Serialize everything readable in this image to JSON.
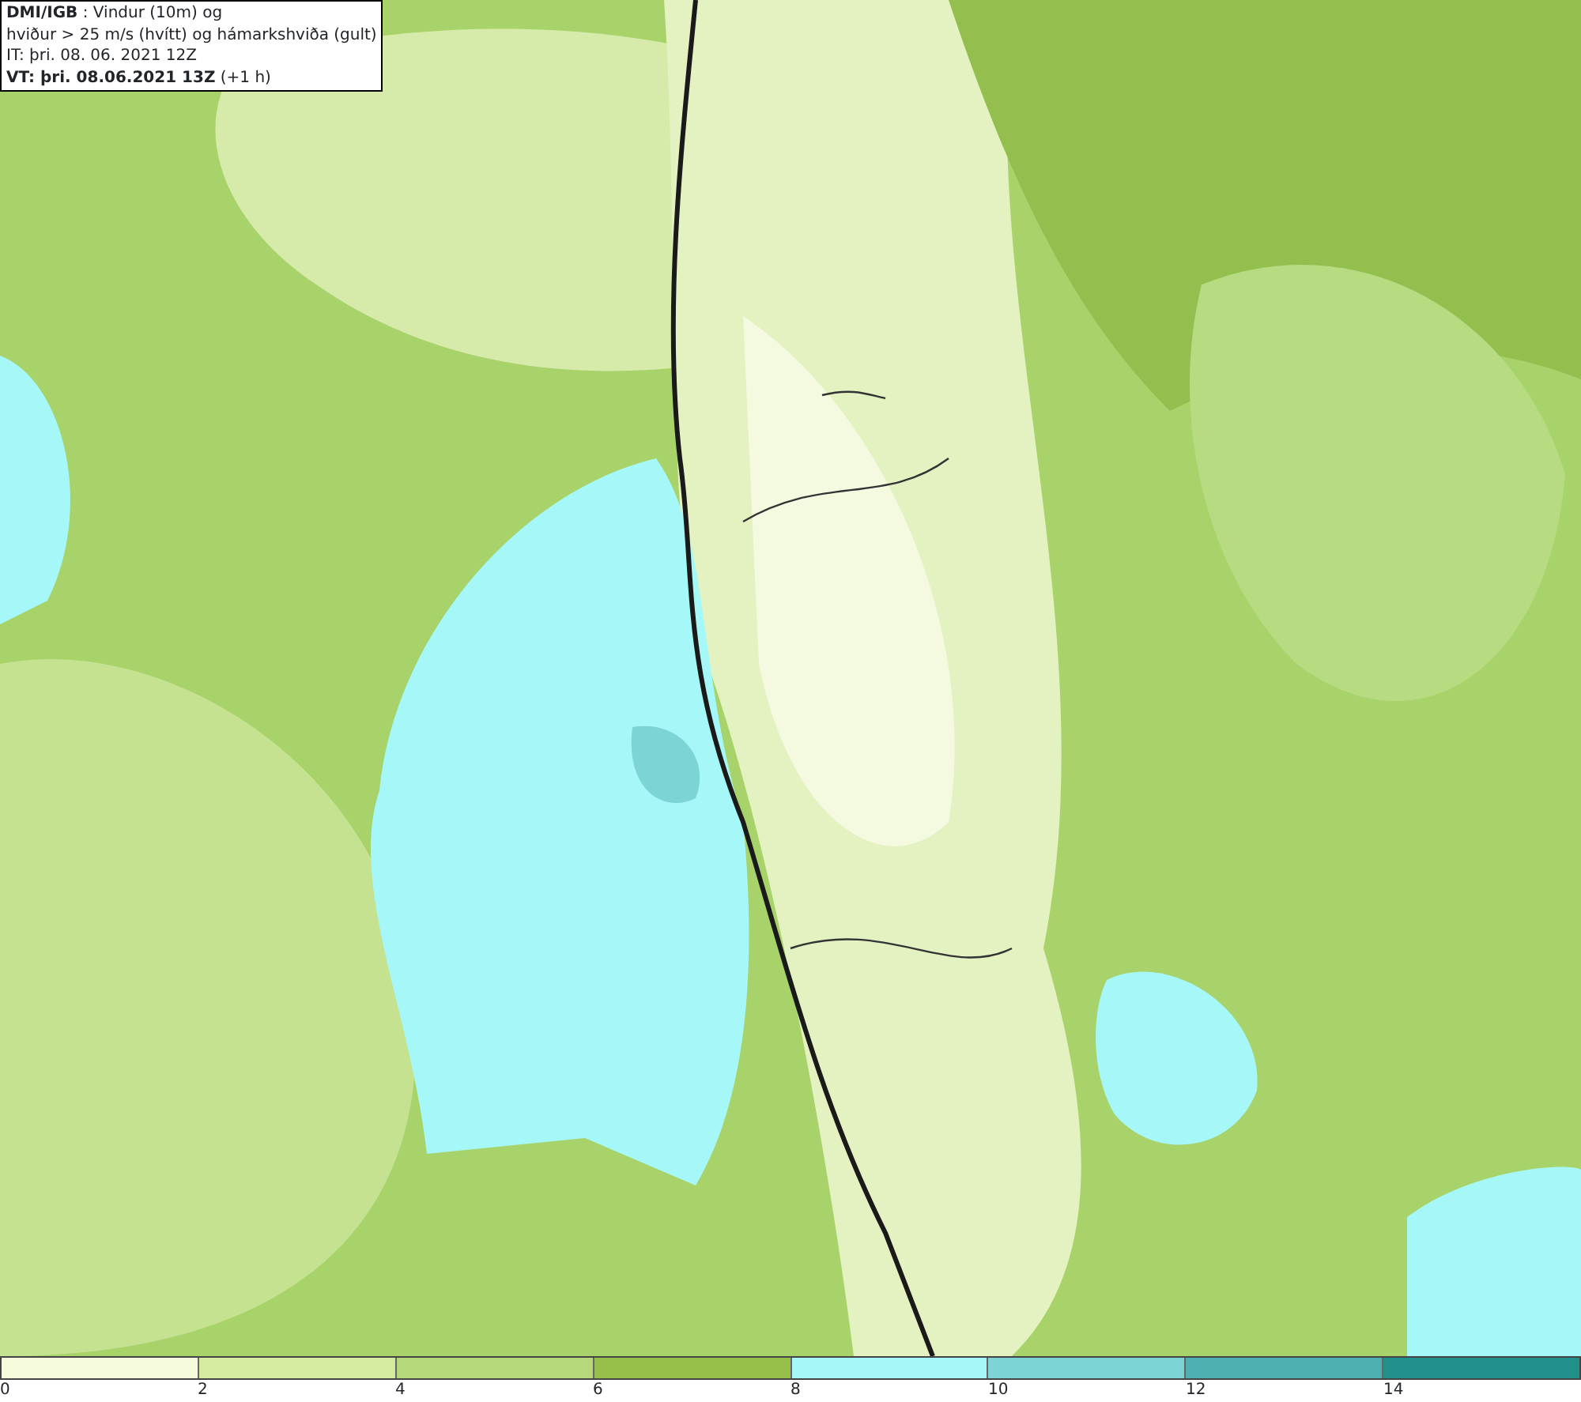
{
  "map": {
    "kind": "map-picture"
  },
  "title_box": {
    "lines": [
      "**DMI/IGB** : Vindur (10m) og",
      "hviður > 25 m/s (hvítt) og hámarkshviða (gult)",
      "IT: þri. 08. 06. 2021 12Z",
      "**VT: þri. 08.06.2021 13Z** (+1 h)"
    ]
  },
  "legend": [
    {
      "label": "0",
      "color": "#f5fbdc"
    },
    {
      "label": "2",
      "color": "#d4ec9e"
    },
    {
      "label": "4",
      "color": "#b5d97a"
    },
    {
      "label": "6",
      "color": "#96c049"
    },
    {
      "label": "8",
      "color": "#a6f8f8"
    },
    {
      "label": "10",
      "color": "#7dd4d4"
    },
    {
      "label": "12",
      "color": "#4fb0b0"
    },
    {
      "label": "14",
      "color": "#22908a"
    }
  ]
}
